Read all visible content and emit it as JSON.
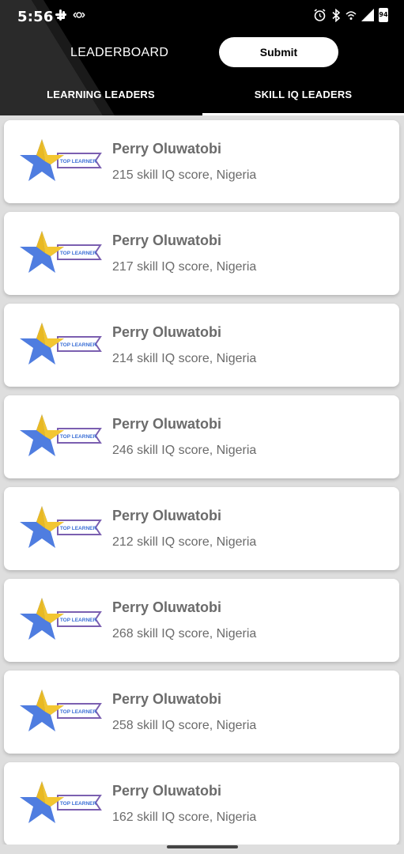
{
  "status_bar": {
    "time": "5:56",
    "left_icons": [
      "slack-icon",
      "vpn-icon"
    ],
    "right_icons": [
      "alarm-icon",
      "bluetooth-icon",
      "wifi-icon",
      "signal-icon",
      "battery-icon"
    ],
    "battery": "94"
  },
  "header": {
    "title": "LEADERBOARD",
    "submit_label": "Submit",
    "tabs": [
      {
        "label": "LEARNING LEADERS",
        "selected": false
      },
      {
        "label": "SKILL IQ LEADERS",
        "selected": true
      }
    ]
  },
  "badge": {
    "icon": "skill-iq-star-badge",
    "text": "TOP LEARNER",
    "colors": {
      "star_blue": "#4f7de0",
      "star_gold": "#f3c631",
      "ribbon": "#7b5fb0"
    }
  },
  "leaders": [
    {
      "name": "Perry Oluwatobi",
      "details": "215 skill IQ score, Nigeria"
    },
    {
      "name": "Perry Oluwatobi",
      "details": "217 skill IQ score, Nigeria"
    },
    {
      "name": "Perry Oluwatobi",
      "details": "214 skill IQ score, Nigeria"
    },
    {
      "name": "Perry Oluwatobi",
      "details": "246 skill IQ score, Nigeria"
    },
    {
      "name": "Perry Oluwatobi",
      "details": "212 skill IQ score, Nigeria"
    },
    {
      "name": "Perry Oluwatobi",
      "details": "268 skill IQ score, Nigeria"
    },
    {
      "name": "Perry Oluwatobi",
      "details": "258 skill IQ score, Nigeria"
    },
    {
      "name": "Perry Oluwatobi",
      "details": "162 skill IQ score, Nigeria"
    }
  ],
  "colors": {
    "header_bg": "#000000",
    "text_gray": "#6b6b6b",
    "list_bg": "#dedede"
  }
}
